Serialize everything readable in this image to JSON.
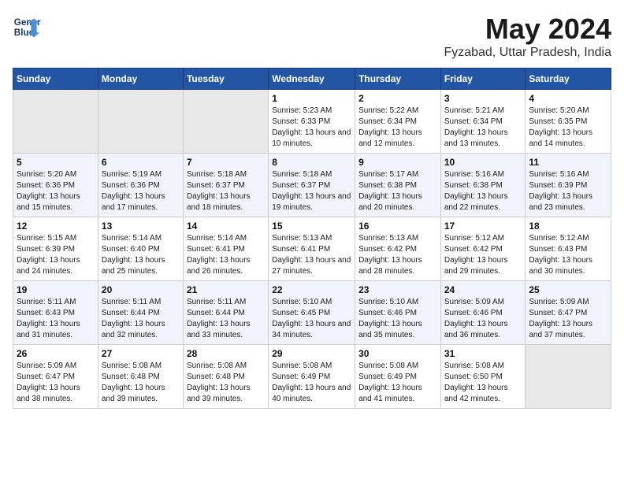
{
  "header": {
    "logo_line1": "General",
    "logo_line2": "Blue",
    "title": "May 2024",
    "subtitle": "Fyzabad, Uttar Pradesh, India"
  },
  "weekdays": [
    "Sunday",
    "Monday",
    "Tuesday",
    "Wednesday",
    "Thursday",
    "Friday",
    "Saturday"
  ],
  "weeks": [
    [
      {
        "day": "",
        "sunrise": "",
        "sunset": "",
        "daylight": "",
        "empty": true
      },
      {
        "day": "",
        "sunrise": "",
        "sunset": "",
        "daylight": "",
        "empty": true
      },
      {
        "day": "",
        "sunrise": "",
        "sunset": "",
        "daylight": "",
        "empty": true
      },
      {
        "day": "1",
        "sunrise": "Sunrise: 5:23 AM",
        "sunset": "Sunset: 6:33 PM",
        "daylight": "Daylight: 13 hours and 10 minutes."
      },
      {
        "day": "2",
        "sunrise": "Sunrise: 5:22 AM",
        "sunset": "Sunset: 6:34 PM",
        "daylight": "Daylight: 13 hours and 12 minutes."
      },
      {
        "day": "3",
        "sunrise": "Sunrise: 5:21 AM",
        "sunset": "Sunset: 6:34 PM",
        "daylight": "Daylight: 13 hours and 13 minutes."
      },
      {
        "day": "4",
        "sunrise": "Sunrise: 5:20 AM",
        "sunset": "Sunset: 6:35 PM",
        "daylight": "Daylight: 13 hours and 14 minutes."
      }
    ],
    [
      {
        "day": "5",
        "sunrise": "Sunrise: 5:20 AM",
        "sunset": "Sunset: 6:36 PM",
        "daylight": "Daylight: 13 hours and 15 minutes."
      },
      {
        "day": "6",
        "sunrise": "Sunrise: 5:19 AM",
        "sunset": "Sunset: 6:36 PM",
        "daylight": "Daylight: 13 hours and 17 minutes."
      },
      {
        "day": "7",
        "sunrise": "Sunrise: 5:18 AM",
        "sunset": "Sunset: 6:37 PM",
        "daylight": "Daylight: 13 hours and 18 minutes."
      },
      {
        "day": "8",
        "sunrise": "Sunrise: 5:18 AM",
        "sunset": "Sunset: 6:37 PM",
        "daylight": "Daylight: 13 hours and 19 minutes."
      },
      {
        "day": "9",
        "sunrise": "Sunrise: 5:17 AM",
        "sunset": "Sunset: 6:38 PM",
        "daylight": "Daylight: 13 hours and 20 minutes."
      },
      {
        "day": "10",
        "sunrise": "Sunrise: 5:16 AM",
        "sunset": "Sunset: 6:38 PM",
        "daylight": "Daylight: 13 hours and 22 minutes."
      },
      {
        "day": "11",
        "sunrise": "Sunrise: 5:16 AM",
        "sunset": "Sunset: 6:39 PM",
        "daylight": "Daylight: 13 hours and 23 minutes."
      }
    ],
    [
      {
        "day": "12",
        "sunrise": "Sunrise: 5:15 AM",
        "sunset": "Sunset: 6:39 PM",
        "daylight": "Daylight: 13 hours and 24 minutes."
      },
      {
        "day": "13",
        "sunrise": "Sunrise: 5:14 AM",
        "sunset": "Sunset: 6:40 PM",
        "daylight": "Daylight: 13 hours and 25 minutes."
      },
      {
        "day": "14",
        "sunrise": "Sunrise: 5:14 AM",
        "sunset": "Sunset: 6:41 PM",
        "daylight": "Daylight: 13 hours and 26 minutes."
      },
      {
        "day": "15",
        "sunrise": "Sunrise: 5:13 AM",
        "sunset": "Sunset: 6:41 PM",
        "daylight": "Daylight: 13 hours and 27 minutes."
      },
      {
        "day": "16",
        "sunrise": "Sunrise: 5:13 AM",
        "sunset": "Sunset: 6:42 PM",
        "daylight": "Daylight: 13 hours and 28 minutes."
      },
      {
        "day": "17",
        "sunrise": "Sunrise: 5:12 AM",
        "sunset": "Sunset: 6:42 PM",
        "daylight": "Daylight: 13 hours and 29 minutes."
      },
      {
        "day": "18",
        "sunrise": "Sunrise: 5:12 AM",
        "sunset": "Sunset: 6:43 PM",
        "daylight": "Daylight: 13 hours and 30 minutes."
      }
    ],
    [
      {
        "day": "19",
        "sunrise": "Sunrise: 5:11 AM",
        "sunset": "Sunset: 6:43 PM",
        "daylight": "Daylight: 13 hours and 31 minutes."
      },
      {
        "day": "20",
        "sunrise": "Sunrise: 5:11 AM",
        "sunset": "Sunset: 6:44 PM",
        "daylight": "Daylight: 13 hours and 32 minutes."
      },
      {
        "day": "21",
        "sunrise": "Sunrise: 5:11 AM",
        "sunset": "Sunset: 6:44 PM",
        "daylight": "Daylight: 13 hours and 33 minutes."
      },
      {
        "day": "22",
        "sunrise": "Sunrise: 5:10 AM",
        "sunset": "Sunset: 6:45 PM",
        "daylight": "Daylight: 13 hours and 34 minutes."
      },
      {
        "day": "23",
        "sunrise": "Sunrise: 5:10 AM",
        "sunset": "Sunset: 6:46 PM",
        "daylight": "Daylight: 13 hours and 35 minutes."
      },
      {
        "day": "24",
        "sunrise": "Sunrise: 5:09 AM",
        "sunset": "Sunset: 6:46 PM",
        "daylight": "Daylight: 13 hours and 36 minutes."
      },
      {
        "day": "25",
        "sunrise": "Sunrise: 5:09 AM",
        "sunset": "Sunset: 6:47 PM",
        "daylight": "Daylight: 13 hours and 37 minutes."
      }
    ],
    [
      {
        "day": "26",
        "sunrise": "Sunrise: 5:09 AM",
        "sunset": "Sunset: 6:47 PM",
        "daylight": "Daylight: 13 hours and 38 minutes."
      },
      {
        "day": "27",
        "sunrise": "Sunrise: 5:08 AM",
        "sunset": "Sunset: 6:48 PM",
        "daylight": "Daylight: 13 hours and 39 minutes."
      },
      {
        "day": "28",
        "sunrise": "Sunrise: 5:08 AM",
        "sunset": "Sunset: 6:48 PM",
        "daylight": "Daylight: 13 hours and 39 minutes."
      },
      {
        "day": "29",
        "sunrise": "Sunrise: 5:08 AM",
        "sunset": "Sunset: 6:49 PM",
        "daylight": "Daylight: 13 hours and 40 minutes."
      },
      {
        "day": "30",
        "sunrise": "Sunrise: 5:08 AM",
        "sunset": "Sunset: 6:49 PM",
        "daylight": "Daylight: 13 hours and 41 minutes."
      },
      {
        "day": "31",
        "sunrise": "Sunrise: 5:08 AM",
        "sunset": "Sunset: 6:50 PM",
        "daylight": "Daylight: 13 hours and 42 minutes."
      },
      {
        "day": "",
        "sunrise": "",
        "sunset": "",
        "daylight": "",
        "empty": true
      }
    ]
  ]
}
